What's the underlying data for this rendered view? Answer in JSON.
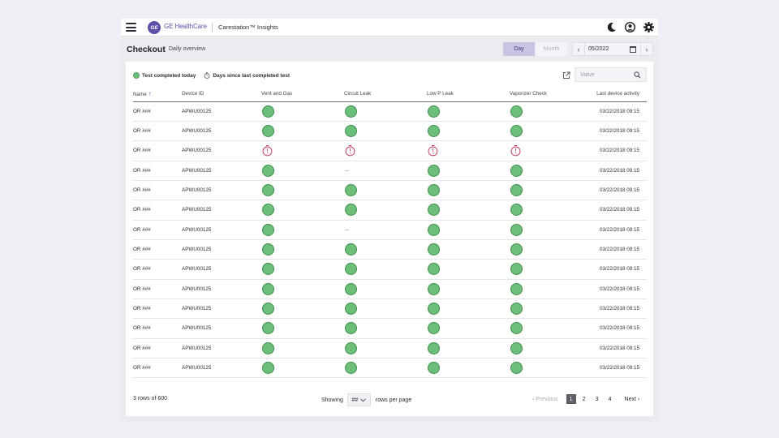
{
  "header": {
    "brand": "GE HealthCare",
    "logo_text": "GE",
    "product": "Carestation™ Insights",
    "icons": [
      "menu-icon",
      "dark-mode-icon",
      "user-account-icon",
      "settings-icon"
    ]
  },
  "page": {
    "title": "Checkout",
    "subtitle": "Daily overview",
    "view_toggle": {
      "day": "Day",
      "month": "Month",
      "selected": "Day"
    },
    "date": "05/2022"
  },
  "legend": {
    "completed": "Test completed today",
    "days_since": "Days since last completed test"
  },
  "search": {
    "placeholder": "Value"
  },
  "colors": {
    "accent": "#5b4fa8",
    "status_ok": "#6cbf79",
    "status_overdue": "#c0395a"
  },
  "table": {
    "columns": [
      "Name",
      "Device ID",
      "Vent and Gas",
      "Circuit Leak",
      "Low P Leak",
      "Vaporizer Check",
      "Last device activity"
    ],
    "rows": [
      {
        "name": "OR ###",
        "device_id": "APWU00125",
        "vent": "ok",
        "circuit": "ok",
        "lowp": "ok",
        "vapor": "ok",
        "last": "03/22/2018  09:15"
      },
      {
        "name": "OR ###",
        "device_id": "APWU00125",
        "vent": "ok",
        "circuit": "ok",
        "lowp": "ok",
        "vapor": "ok",
        "last": "03/22/2018  09:15"
      },
      {
        "name": "OR ###",
        "device_id": "APWU00125",
        "vent": "timer",
        "circuit": "timer",
        "lowp": "timer",
        "vapor": "timer",
        "last": "03/22/2018  09:15"
      },
      {
        "name": "OR ###",
        "device_id": "APWU00125",
        "vent": "ok",
        "circuit": "--",
        "lowp": "ok",
        "vapor": "ok",
        "last": "03/22/2018  09:15"
      },
      {
        "name": "OR ###",
        "device_id": "APWU00125",
        "vent": "ok",
        "circuit": "ok",
        "lowp": "ok",
        "vapor": "ok",
        "last": "03/22/2018  09:15"
      },
      {
        "name": "OR ###",
        "device_id": "APWU00125",
        "vent": "ok",
        "circuit": "ok",
        "lowp": "ok",
        "vapor": "ok",
        "last": "03/22/2018  09:15"
      },
      {
        "name": "OR ###",
        "device_id": "APWU00125",
        "vent": "ok",
        "circuit": "--",
        "lowp": "ok",
        "vapor": "ok",
        "last": "03/22/2018  09:15"
      },
      {
        "name": "OR ###",
        "device_id": "APWU00125",
        "vent": "ok",
        "circuit": "ok",
        "lowp": "ok",
        "vapor": "ok",
        "last": "03/22/2018  09:15"
      },
      {
        "name": "OR ###",
        "device_id": "APWU00125",
        "vent": "ok",
        "circuit": "ok",
        "lowp": "ok",
        "vapor": "ok",
        "last": "03/22/2018  09:15"
      },
      {
        "name": "OR ###",
        "device_id": "APWU00125",
        "vent": "ok",
        "circuit": "ok",
        "lowp": "ok",
        "vapor": "ok",
        "last": "03/22/2018  09:15"
      },
      {
        "name": "OR ###",
        "device_id": "APWU00125",
        "vent": "ok",
        "circuit": "ok",
        "lowp": "ok",
        "vapor": "ok",
        "last": "03/22/2018  09:15"
      },
      {
        "name": "OR ###",
        "device_id": "APWU00125",
        "vent": "ok",
        "circuit": "ok",
        "lowp": "ok",
        "vapor": "ok",
        "last": "03/22/2018  09:15"
      },
      {
        "name": "OR ###",
        "device_id": "APWU00125",
        "vent": "ok",
        "circuit": "ok",
        "lowp": "ok",
        "vapor": "ok",
        "last": "03/22/2018  09:15"
      },
      {
        "name": "OR ###",
        "device_id": "APWU00125",
        "vent": "ok",
        "circuit": "ok",
        "lowp": "ok",
        "vapor": "ok",
        "last": "03/22/2018  09:15"
      }
    ]
  },
  "footer": {
    "count": "3 rows of 600",
    "showing": "Showing",
    "per_page_value": "##",
    "rows_per_page": "rows per page",
    "previous": "Previous",
    "pages": [
      "1",
      "2",
      "3",
      "4"
    ],
    "current_page": "1",
    "next": "Next"
  }
}
